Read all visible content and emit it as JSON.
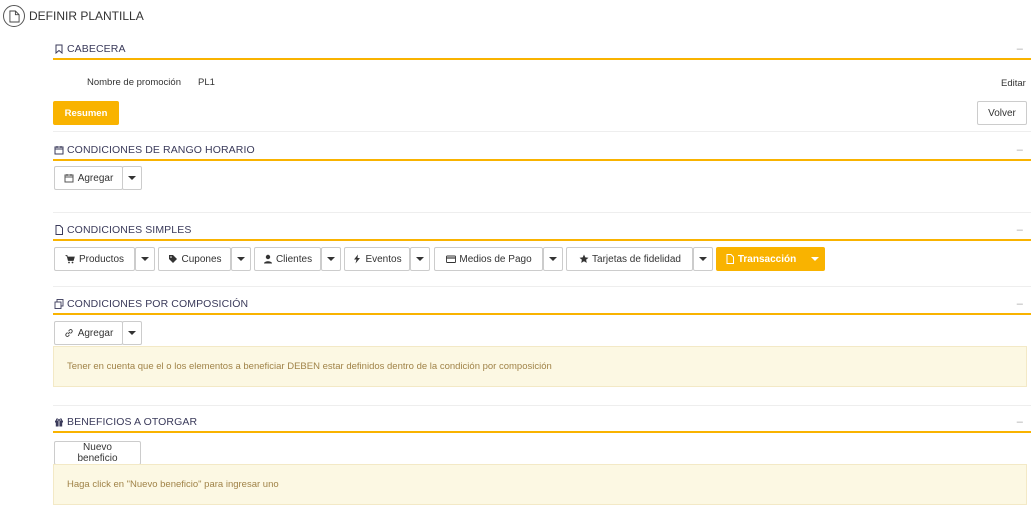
{
  "page": {
    "title": "DEFINIR PLANTILLA"
  },
  "cabecera": {
    "title": "CABECERA",
    "collapse": "–",
    "field_label": "Nombre de promoción",
    "field_value": "PL1",
    "edit_label": "Editar",
    "resumen_label": "Resumen",
    "volver_label": "Volver"
  },
  "rango_horario": {
    "title": "CONDICIONES DE RANGO HORARIO",
    "collapse": "–",
    "agregar_label": "Agregar"
  },
  "simples": {
    "title": "CONDICIONES SIMPLES",
    "collapse": "–",
    "buttons": [
      "Productos",
      "Cupones",
      "Clientes",
      "Eventos",
      "Medios de Pago",
      "Tarjetas de fidelidad",
      "Transacción"
    ]
  },
  "composicion": {
    "title": "CONDICIONES POR COMPOSICIÓN",
    "collapse": "–",
    "agregar_label": "Agregar",
    "notice": "Tener en cuenta que el o los elementos a beneficiar DEBEN estar definidos dentro de la condición por composición"
  },
  "beneficios": {
    "title": "BENEFICIOS A OTORGAR",
    "collapse": "–",
    "nuevo_label": "Nuevo beneficio",
    "notice": "Haga click en \"Nuevo beneficio\" para ingresar uno"
  },
  "colors": {
    "accent": "#f9b300",
    "alert_bg": "#fcf8e3",
    "alert_text": "#a08348"
  },
  "icons": {
    "page": "document-icon",
    "cabecera": "bookmark-icon",
    "rango": "calendar-icon",
    "simples": "file-icon",
    "composicion": "copy-icon",
    "beneficios": "gift-icon"
  }
}
